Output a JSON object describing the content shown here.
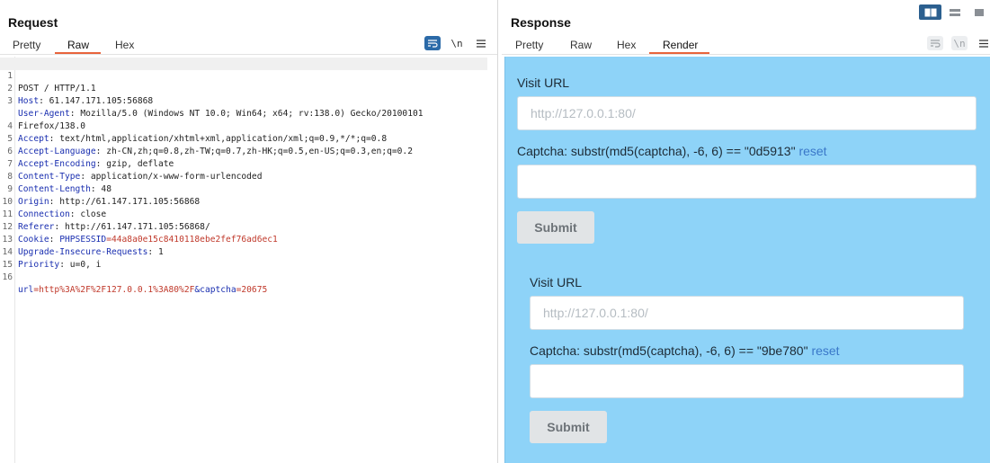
{
  "request": {
    "title": "Request",
    "tabs": [
      "Pretty",
      "Raw",
      "Hex"
    ],
    "active_tab": "Raw",
    "icons": [
      "wrap-icon",
      "newline-icon",
      "menu-icon"
    ],
    "newline_label": "\\n",
    "lines": [
      {
        "n": "1",
        "text": "POST / HTTP/1.1"
      },
      {
        "n": "2",
        "key": "Host",
        "value": " 61.147.171.105:56868"
      },
      {
        "n": "3",
        "key": "User-Agent",
        "value": " Mozilla/5.0 (Windows NT 10.0; Win64; x64; rv:138.0) Gecko/20100101"
      },
      {
        "n": "",
        "text": "Firefox/138.0"
      },
      {
        "n": "4",
        "key": "Accept",
        "value": " text/html,application/xhtml+xml,application/xml;q=0.9,*/*;q=0.8"
      },
      {
        "n": "5",
        "key": "Accept-Language",
        "value": " zh-CN,zh;q=0.8,zh-TW;q=0.7,zh-HK;q=0.5,en-US;q=0.3,en;q=0.2"
      },
      {
        "n": "6",
        "key": "Accept-Encoding",
        "value": " gzip, deflate"
      },
      {
        "n": "7",
        "key": "Content-Type",
        "value": " application/x-www-form-urlencoded"
      },
      {
        "n": "8",
        "key": "Content-Length",
        "value": " 48"
      },
      {
        "n": "9",
        "key": "Origin",
        "value": " http://61.147.171.105:56868"
      },
      {
        "n": "10",
        "key": "Connection",
        "value": " close"
      },
      {
        "n": "11",
        "key": "Referer",
        "value": " http://61.147.171.105:56868/"
      },
      {
        "n": "12",
        "key": "Cookie",
        "value": " ",
        "cookie_name": "PHPSESSID",
        "cookie_value": "=44a8a0e15c8410118ebe2fef76ad6ec1"
      },
      {
        "n": "13",
        "key": "Upgrade-Insecure-Requests",
        "value": " 1"
      },
      {
        "n": "14",
        "key": "Priority",
        "value": " u=0, i"
      },
      {
        "n": "15",
        "text": ""
      },
      {
        "n": "16",
        "body": [
          {
            "k": "url",
            "v": "=http%3A%2F%2F127.0.0.1%3A80%2F"
          },
          {
            "k": "&captcha",
            "v": "=20675"
          }
        ]
      }
    ]
  },
  "response": {
    "title": "Response",
    "tabs": [
      "Pretty",
      "Raw",
      "Hex",
      "Render"
    ],
    "active_tab": "Render",
    "newline_label": "\\n",
    "forms": [
      {
        "url_label": "Visit URL",
        "url_placeholder": "http://127.0.0.1:80/",
        "captcha_label": "Captcha: substr(md5(captcha), -6, 6) == \"0d5913\"",
        "reset_label": "reset",
        "submit_label": "Submit"
      },
      {
        "url_label": "Visit URL",
        "url_placeholder": "http://127.0.0.1:80/",
        "captcha_label": "Captcha: substr(md5(captcha), -6, 6) == \"9be780\"",
        "reset_label": "reset",
        "submit_label": "Submit"
      }
    ]
  },
  "colors": {
    "accent": "#e8643c",
    "header_key": "#1a2fb0",
    "cookie_value": "#c0392b",
    "render_bg": "#8ed3f8",
    "link": "#3a78c9",
    "layout_active": "#2b5f8f"
  }
}
